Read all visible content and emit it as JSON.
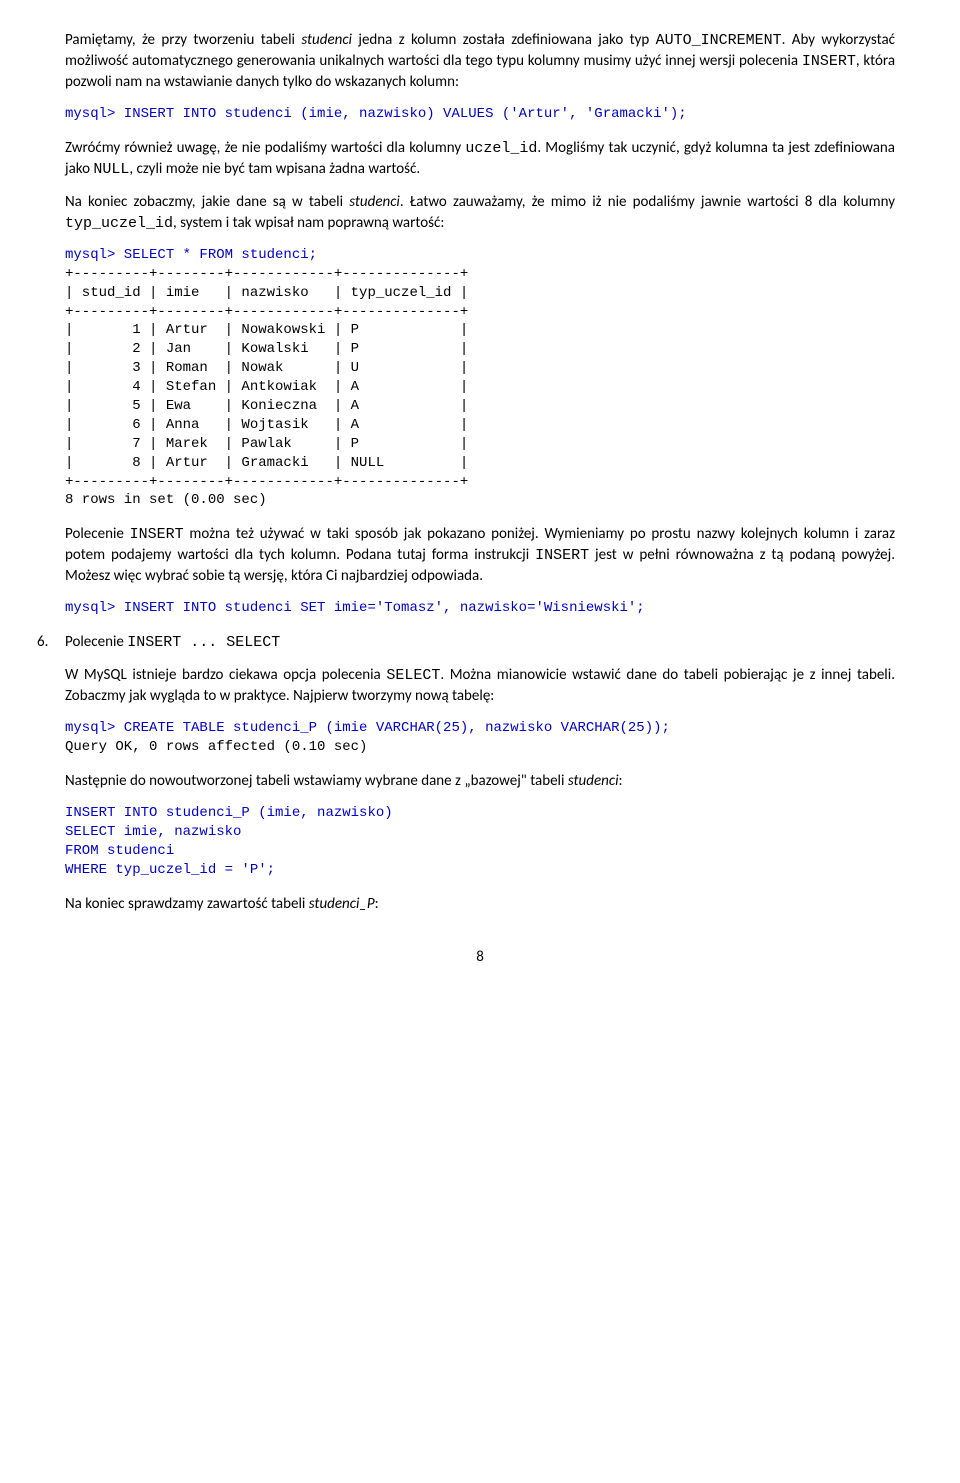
{
  "p1a": "Pamiętamy, że przy tworzeniu tabeli ",
  "p1b": "studenci",
  "p1c": " jedna z kolumn została zdefiniowana jako typ ",
  "p1d": "AUTO_INCREMENT",
  "p1e": ". Aby wykorzystać możliwość automatycznego generowania unikalnych wartości dla tego typu kolumny musimy użyć innej wersji polecenia ",
  "p1f": "INSERT",
  "p1g": ", która pozwoli nam na wstawianie danych tylko do wskazanych kolumn:",
  "sql1": "mysql> INSERT INTO studenci (imie, nazwisko) VALUES ('Artur', 'Gramacki');",
  "p2a": "Zwróćmy również uwagę, że nie podaliśmy wartości dla kolumny ",
  "p2b": "uczel_id",
  "p2c": ". Mogliśmy tak uczynić, gdyż kolumna ta jest zdefiniowana jako ",
  "p2d": "NULL",
  "p2e": ", czyli może nie być tam wpisana żadna wartość.",
  "p3a": "Na koniec zobaczmy, jakie dane są w tabeli ",
  "p3b": "studenci",
  "p3c": ". Łatwo zauważamy, że mimo iż nie podaliśmy jawnie wartości 8 dla kolumny ",
  "p3d": "typ_uczel_id",
  "p3e": ", system i tak wpisał nam poprawną wartość:",
  "sql2": "mysql> SELECT * FROM studenci;",
  "table": "+---------+--------+------------+--------------+\n| stud_id | imie   | nazwisko   | typ_uczel_id |\n+---------+--------+------------+--------------+\n|       1 | Artur  | Nowakowski | P            |\n|       2 | Jan    | Kowalski   | P            |\n|       3 | Roman  | Nowak      | U            |\n|       4 | Stefan | Antkowiak  | A            |\n|       5 | Ewa    | Konieczna  | A            |\n|       6 | Anna   | Wojtasik   | A            |\n|       7 | Marek  | Pawlak     | P            |\n|       8 | Artur  | Gramacki   | NULL         |\n+---------+--------+------------+--------------+\n8 rows in set (0.00 sec)",
  "p4a": "Polecenie ",
  "p4b": "INSERT",
  "p4c": " można też używać w taki sposób jak pokazano poniżej. Wymieniamy po prostu nazwy kolejnych kolumn i zaraz potem podajemy wartości dla tych kolumn. Podana tutaj forma instrukcji ",
  "p4d": "INSERT",
  "p4e": " jest w pełni równoważna z tą podaną powyżej. Możesz więc wybrać sobie tą wersję, która Ci najbardziej odpowiada.",
  "sql3": "mysql> INSERT INTO studenci SET imie='Tomasz', nazwisko='Wisniewski';",
  "li_num": "6.",
  "li_a": "Polecenie ",
  "li_b": "INSERT ... SELECT",
  "p5a": "W MySQL istnieje bardzo ciekawa opcja polecenia ",
  "p5b": "SELECT",
  "p5c": ". Można mianowicie wstawić dane do tabeli pobierając je z innej tabeli. Zobaczmy jak wygląda to w praktyce. Najpierw tworzymy nową tabelę:",
  "sql4a": "mysql> CREATE TABLE studenci_P (imie VARCHAR(25), nazwisko VARCHAR(25));",
  "sql4b": "Query OK, 0 rows affected (0.10 sec)",
  "p6a": "Następnie do nowoutworzonej tabeli wstawiamy wybrane dane z „bazowej\" tabeli ",
  "p6b": "studenci",
  "p6c": ":",
  "sql5": "INSERT INTO studenci_P (imie, nazwisko)\nSELECT imie, nazwisko\nFROM studenci\nWHERE typ_uczel_id = 'P';",
  "p7a": "Na koniec sprawdzamy zawartość tabeli ",
  "p7b": "studenci_P",
  "p7c": ":",
  "page": "8"
}
